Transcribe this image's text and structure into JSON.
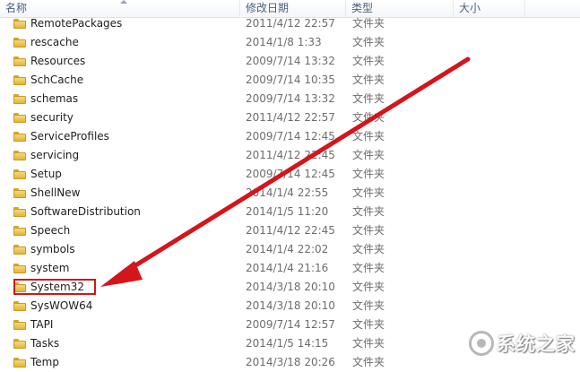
{
  "columns": {
    "name": "名称",
    "date": "修改日期",
    "type": "类型",
    "size": "大小"
  },
  "folders": [
    {
      "name": "RemotePackages",
      "date": "2011/4/12 22:57",
      "type": "文件夹"
    },
    {
      "name": "rescache",
      "date": "2014/1/8 1:33",
      "type": "文件夹"
    },
    {
      "name": "Resources",
      "date": "2009/7/14 13:32",
      "type": "文件夹"
    },
    {
      "name": "SchCache",
      "date": "2009/7/14 10:35",
      "type": "文件夹"
    },
    {
      "name": "schemas",
      "date": "2009/7/14 13:32",
      "type": "文件夹"
    },
    {
      "name": "security",
      "date": "2011/4/12 22:57",
      "type": "文件夹"
    },
    {
      "name": "ServiceProfiles",
      "date": "2009/7/14 12:45",
      "type": "文件夹"
    },
    {
      "name": "servicing",
      "date": "2011/4/12 22:45",
      "type": "文件夹"
    },
    {
      "name": "Setup",
      "date": "2009/7/14 12:45",
      "type": "文件夹"
    },
    {
      "name": "ShellNew",
      "date": "2014/1/4 22:55",
      "type": "文件夹"
    },
    {
      "name": "SoftwareDistribution",
      "date": "2014/1/5 11:20",
      "type": "文件夹"
    },
    {
      "name": "Speech",
      "date": "2011/4/12 22:45",
      "type": "文件夹"
    },
    {
      "name": "symbols",
      "date": "2014/1/4 22:02",
      "type": "文件夹"
    },
    {
      "name": "system",
      "date": "2014/1/4 21:16",
      "type": "文件夹"
    },
    {
      "name": "System32",
      "date": "2014/3/18 20:10",
      "type": "文件夹"
    },
    {
      "name": "SysWOW64",
      "date": "2014/3/18 20:10",
      "type": "文件夹"
    },
    {
      "name": "TAPI",
      "date": "2009/7/14 12:57",
      "type": "文件夹"
    },
    {
      "name": "Tasks",
      "date": "2014/1/5 14:15",
      "type": "文件夹"
    },
    {
      "name": "Temp",
      "date": "2014/3/18 20:26",
      "type": "文件夹"
    }
  ],
  "annotation": {
    "highlighted_folder": "System32",
    "color": "#d4151b"
  },
  "watermark": {
    "text": "系统之家"
  }
}
